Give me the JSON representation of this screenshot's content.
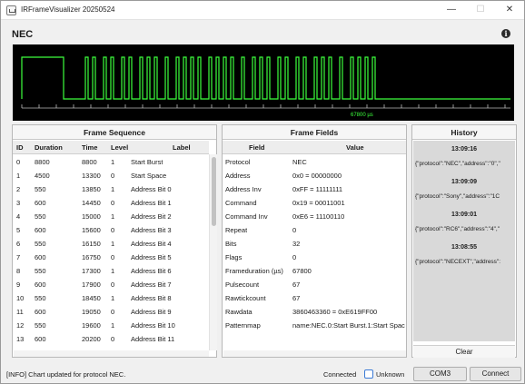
{
  "window": {
    "title": "IRFrameVisualizer 20250524",
    "min_glyph": "—",
    "max_glyph": "☐",
    "close_glyph": "✕"
  },
  "header": {
    "protocol": "NEC",
    "info_glyph": "i"
  },
  "waveform": {
    "cursor_label": "67800 µs",
    "trace_color": "#3cff3c"
  },
  "frame_sequence": {
    "title": "Frame Sequence",
    "columns": [
      "ID",
      "Duration",
      "Time",
      "Level",
      "Label"
    ],
    "rows": [
      [
        "0",
        "8800",
        "8800",
        "1",
        "Start Burst"
      ],
      [
        "1",
        "4500",
        "13300",
        "0",
        "Start Space"
      ],
      [
        "2",
        "550",
        "13850",
        "1",
        "Address Bit 0"
      ],
      [
        "3",
        "600",
        "14450",
        "0",
        "Address Bit 1"
      ],
      [
        "4",
        "550",
        "15000",
        "1",
        "Address Bit 2"
      ],
      [
        "5",
        "600",
        "15600",
        "0",
        "Address Bit 3"
      ],
      [
        "6",
        "550",
        "16150",
        "1",
        "Address Bit 4"
      ],
      [
        "7",
        "600",
        "16750",
        "0",
        "Address Bit 5"
      ],
      [
        "8",
        "550",
        "17300",
        "1",
        "Address Bit 6"
      ],
      [
        "9",
        "600",
        "17900",
        "0",
        "Address Bit 7"
      ],
      [
        "10",
        "550",
        "18450",
        "1",
        "Address Bit 8"
      ],
      [
        "11",
        "600",
        "19050",
        "0",
        "Address Bit 9"
      ],
      [
        "12",
        "550",
        "19600",
        "1",
        "Address Bit 10"
      ],
      [
        "13",
        "600",
        "20200",
        "0",
        "Address Bit 11"
      ]
    ]
  },
  "frame_fields": {
    "title": "Frame Fields",
    "columns": [
      "Field",
      "Value"
    ],
    "rows": [
      [
        "Protocol",
        "NEC"
      ],
      [
        "Address",
        "0x0 = 00000000"
      ],
      [
        "Address Inv",
        "0xFF = 11111111"
      ],
      [
        "Command",
        "0x19 = 00011001"
      ],
      [
        "Command Inv",
        "0xE6 = 11100110"
      ],
      [
        "Repeat",
        "0"
      ],
      [
        "Bits",
        "32"
      ],
      [
        "Flags",
        "0"
      ],
      [
        "Frameduration (µs)",
        "67800"
      ],
      [
        "Pulsecount",
        "67"
      ],
      [
        "Rawtickcount",
        "67"
      ],
      [
        "Rawdata",
        "3860463360 = 0xE619FF00"
      ],
      [
        "Patternmap",
        "name:NEC.0:Start Burst.1:Start Space"
      ]
    ]
  },
  "history": {
    "title": "History",
    "entries": [
      {
        "time": "13:09:16",
        "json": "{\"protocol\":\"NEC\",\"address\":\"0\",\""
      },
      {
        "time": "13:09:09",
        "json": "{\"protocol\":\"Sony\",\"address\":\"1C"
      },
      {
        "time": "13:09:01",
        "json": "{\"protocol\":\"RC6\",\"address\":\"4\",\""
      },
      {
        "time": "13:08:55",
        "json": "{\"protocol\":\"NECEXT\",\"address\":"
      }
    ],
    "clear_label": "Clear"
  },
  "status": {
    "message": "[INFO] Chart updated for protocol NEC.",
    "connection": "Connected",
    "unknown_label": "Unknown",
    "port_button": "COM3",
    "connect_button": "Connect"
  }
}
